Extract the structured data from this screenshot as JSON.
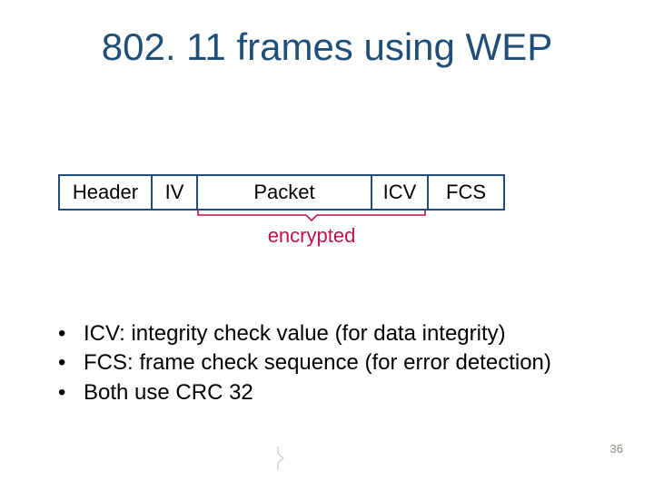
{
  "title": "802. 11 frames using WEP",
  "frame": {
    "header": "Header",
    "iv": "IV",
    "packet": "Packet",
    "icv": "ICV",
    "fcs": "FCS"
  },
  "encrypted_label": "encrypted",
  "bullets": [
    "ICV: integrity check value (for data integrity)",
    "FCS: frame check sequence (for error detection)",
    "Both use CRC 32"
  ],
  "page_number": "36",
  "colors": {
    "title": "#1f4e79",
    "border": "#1f4e79",
    "accent": "#c0104d"
  }
}
